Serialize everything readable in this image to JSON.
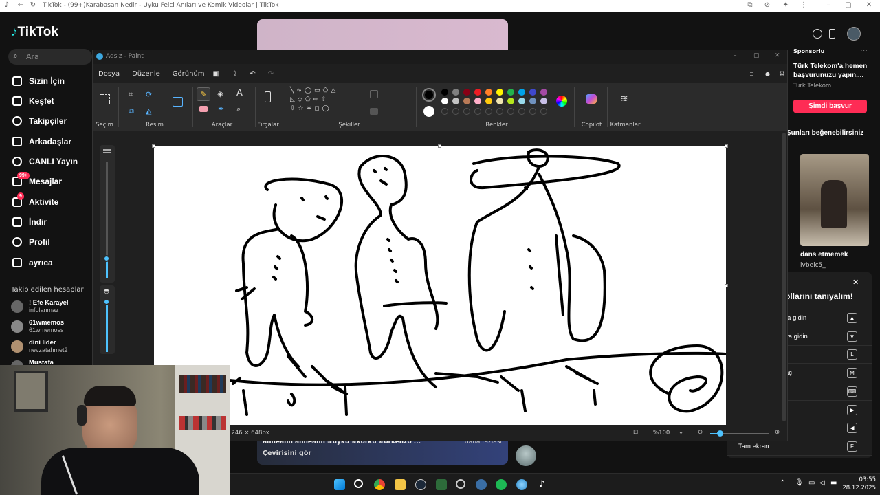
{
  "browser": {
    "tab_title": "TikTok - (99+)Karabasan Nedir - Uyku Felci Anıları ve Komik Videolar | TikTok"
  },
  "tiktok": {
    "logo": "TikTok",
    "search_placeholder": "Ara",
    "nav": [
      {
        "label": "Sizin İçin",
        "icon": "home-icon"
      },
      {
        "label": "Keşfet",
        "icon": "compass-icon"
      },
      {
        "label": "Takipçiler",
        "icon": "followers-avatar-icon"
      },
      {
        "label": "Arkadaşlar",
        "icon": "friends-icon"
      },
      {
        "label": "CANLI Yayın",
        "icon": "live-avatar-icon"
      },
      {
        "label": "Mesajlar",
        "icon": "messages-icon",
        "badge": "99+"
      },
      {
        "label": "Aktivite",
        "icon": "activity-icon",
        "badge": "9"
      },
      {
        "label": "İndir",
        "icon": "download-icon"
      },
      {
        "label": "Profil",
        "icon": "profile-avatar-icon"
      },
      {
        "label": "ayrıca",
        "icon": "more-dots-icon"
      }
    ],
    "following_title": "Takip edilen hesaplar",
    "following": [
      {
        "name": "! Efe Karayel",
        "handle": "infolanmaz"
      },
      {
        "name": "61wmemos",
        "handle": "61wmemoss"
      },
      {
        "name": "dini lider",
        "handle": "nevzatahmet2"
      },
      {
        "name": "Mustafa",
        "handle": ""
      }
    ],
    "sponsor": {
      "label": "Sponsorlu",
      "title": "Türk Telekom'a hemen başvurunuzu yapın....",
      "advertiser": "Türk Telekom",
      "cta": "Şimdi başvur"
    },
    "suggest_title": "Şunları beğenebilirsiniz",
    "suggest_video": {
      "caption": "dans etmemek",
      "user": "lvbelc5_"
    },
    "shortcuts_title": "ollarını tanıyalım!",
    "shortcuts": [
      {
        "label": "ra gidin",
        "key": "▲"
      },
      {
        "label": "ya gidin",
        "key": "▼"
      },
      {
        "label": "",
        "key": "L"
      },
      {
        "label": "aç",
        "key": "M"
      },
      {
        "label": "",
        "key": "⌨"
      },
      {
        "label": "",
        "key": "▶"
      },
      {
        "label": "",
        "key": "◀"
      },
      {
        "label": "Tam ekran",
        "key": "F"
      }
    ],
    "video_caption": "anneann anneann #uyku #korku #orkenzo ...",
    "video_caption_right": "daha fazlası",
    "translate": "Çevirisini gör"
  },
  "paint": {
    "window_title": "Adsız - Paint",
    "menu": [
      "Dosya",
      "Düzenle",
      "Görünüm"
    ],
    "groups": [
      "Seçim",
      "Resim",
      "Araçlar",
      "Fırçalar",
      "Şekiller",
      "Renkler",
      "Copilot",
      "Katmanlar"
    ],
    "colors_row1": [
      "#000000",
      "#7f7f7f",
      "#880015",
      "#ed1c24",
      "#ff7f27",
      "#fff200",
      "#22b14c",
      "#00a2e8",
      "#3f48cc",
      "#a349a4"
    ],
    "colors_row2": [
      "#ffffff",
      "#c3c3c3",
      "#b97a57",
      "#ffaec9",
      "#ffc90e",
      "#efe4b0",
      "#b5e61d",
      "#99d9ea",
      "#7092be",
      "#c8bfe7"
    ],
    "primary_color": "#000000",
    "secondary_color": "#ffffff",
    "canvas_size": "1246 × 648px",
    "zoom": "%100"
  },
  "taskbar": {
    "time": "03:55",
    "date": "28.12.2025"
  }
}
